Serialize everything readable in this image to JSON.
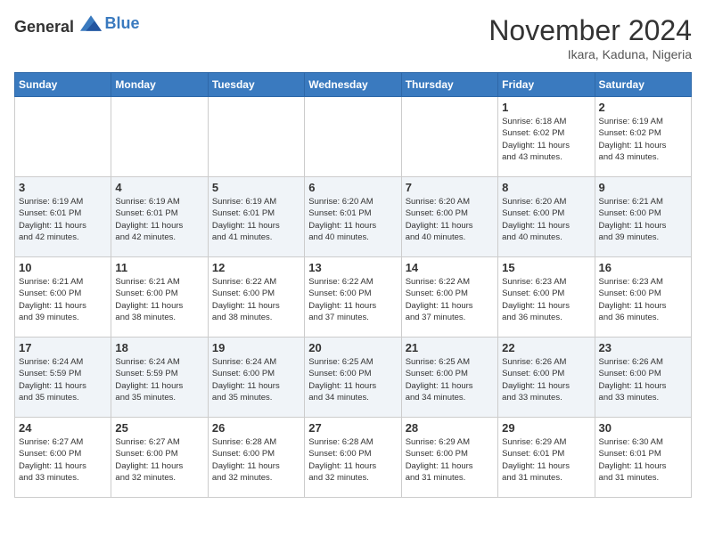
{
  "header": {
    "logo_general": "General",
    "logo_blue": "Blue",
    "month_year": "November 2024",
    "location": "Ikara, Kaduna, Nigeria"
  },
  "weekdays": [
    "Sunday",
    "Monday",
    "Tuesday",
    "Wednesday",
    "Thursday",
    "Friday",
    "Saturday"
  ],
  "weeks": [
    [
      {
        "day": "",
        "info": ""
      },
      {
        "day": "",
        "info": ""
      },
      {
        "day": "",
        "info": ""
      },
      {
        "day": "",
        "info": ""
      },
      {
        "day": "",
        "info": ""
      },
      {
        "day": "1",
        "info": "Sunrise: 6:18 AM\nSunset: 6:02 PM\nDaylight: 11 hours\nand 43 minutes."
      },
      {
        "day": "2",
        "info": "Sunrise: 6:19 AM\nSunset: 6:02 PM\nDaylight: 11 hours\nand 43 minutes."
      }
    ],
    [
      {
        "day": "3",
        "info": "Sunrise: 6:19 AM\nSunset: 6:01 PM\nDaylight: 11 hours\nand 42 minutes."
      },
      {
        "day": "4",
        "info": "Sunrise: 6:19 AM\nSunset: 6:01 PM\nDaylight: 11 hours\nand 42 minutes."
      },
      {
        "day": "5",
        "info": "Sunrise: 6:19 AM\nSunset: 6:01 PM\nDaylight: 11 hours\nand 41 minutes."
      },
      {
        "day": "6",
        "info": "Sunrise: 6:20 AM\nSunset: 6:01 PM\nDaylight: 11 hours\nand 40 minutes."
      },
      {
        "day": "7",
        "info": "Sunrise: 6:20 AM\nSunset: 6:00 PM\nDaylight: 11 hours\nand 40 minutes."
      },
      {
        "day": "8",
        "info": "Sunrise: 6:20 AM\nSunset: 6:00 PM\nDaylight: 11 hours\nand 40 minutes."
      },
      {
        "day": "9",
        "info": "Sunrise: 6:21 AM\nSunset: 6:00 PM\nDaylight: 11 hours\nand 39 minutes."
      }
    ],
    [
      {
        "day": "10",
        "info": "Sunrise: 6:21 AM\nSunset: 6:00 PM\nDaylight: 11 hours\nand 39 minutes."
      },
      {
        "day": "11",
        "info": "Sunrise: 6:21 AM\nSunset: 6:00 PM\nDaylight: 11 hours\nand 38 minutes."
      },
      {
        "day": "12",
        "info": "Sunrise: 6:22 AM\nSunset: 6:00 PM\nDaylight: 11 hours\nand 38 minutes."
      },
      {
        "day": "13",
        "info": "Sunrise: 6:22 AM\nSunset: 6:00 PM\nDaylight: 11 hours\nand 37 minutes."
      },
      {
        "day": "14",
        "info": "Sunrise: 6:22 AM\nSunset: 6:00 PM\nDaylight: 11 hours\nand 37 minutes."
      },
      {
        "day": "15",
        "info": "Sunrise: 6:23 AM\nSunset: 6:00 PM\nDaylight: 11 hours\nand 36 minutes."
      },
      {
        "day": "16",
        "info": "Sunrise: 6:23 AM\nSunset: 6:00 PM\nDaylight: 11 hours\nand 36 minutes."
      }
    ],
    [
      {
        "day": "17",
        "info": "Sunrise: 6:24 AM\nSunset: 5:59 PM\nDaylight: 11 hours\nand 35 minutes."
      },
      {
        "day": "18",
        "info": "Sunrise: 6:24 AM\nSunset: 5:59 PM\nDaylight: 11 hours\nand 35 minutes."
      },
      {
        "day": "19",
        "info": "Sunrise: 6:24 AM\nSunset: 6:00 PM\nDaylight: 11 hours\nand 35 minutes."
      },
      {
        "day": "20",
        "info": "Sunrise: 6:25 AM\nSunset: 6:00 PM\nDaylight: 11 hours\nand 34 minutes."
      },
      {
        "day": "21",
        "info": "Sunrise: 6:25 AM\nSunset: 6:00 PM\nDaylight: 11 hours\nand 34 minutes."
      },
      {
        "day": "22",
        "info": "Sunrise: 6:26 AM\nSunset: 6:00 PM\nDaylight: 11 hours\nand 33 minutes."
      },
      {
        "day": "23",
        "info": "Sunrise: 6:26 AM\nSunset: 6:00 PM\nDaylight: 11 hours\nand 33 minutes."
      }
    ],
    [
      {
        "day": "24",
        "info": "Sunrise: 6:27 AM\nSunset: 6:00 PM\nDaylight: 11 hours\nand 33 minutes."
      },
      {
        "day": "25",
        "info": "Sunrise: 6:27 AM\nSunset: 6:00 PM\nDaylight: 11 hours\nand 32 minutes."
      },
      {
        "day": "26",
        "info": "Sunrise: 6:28 AM\nSunset: 6:00 PM\nDaylight: 11 hours\nand 32 minutes."
      },
      {
        "day": "27",
        "info": "Sunrise: 6:28 AM\nSunset: 6:00 PM\nDaylight: 11 hours\nand 32 minutes."
      },
      {
        "day": "28",
        "info": "Sunrise: 6:29 AM\nSunset: 6:00 PM\nDaylight: 11 hours\nand 31 minutes."
      },
      {
        "day": "29",
        "info": "Sunrise: 6:29 AM\nSunset: 6:01 PM\nDaylight: 11 hours\nand 31 minutes."
      },
      {
        "day": "30",
        "info": "Sunrise: 6:30 AM\nSunset: 6:01 PM\nDaylight: 11 hours\nand 31 minutes."
      }
    ]
  ]
}
